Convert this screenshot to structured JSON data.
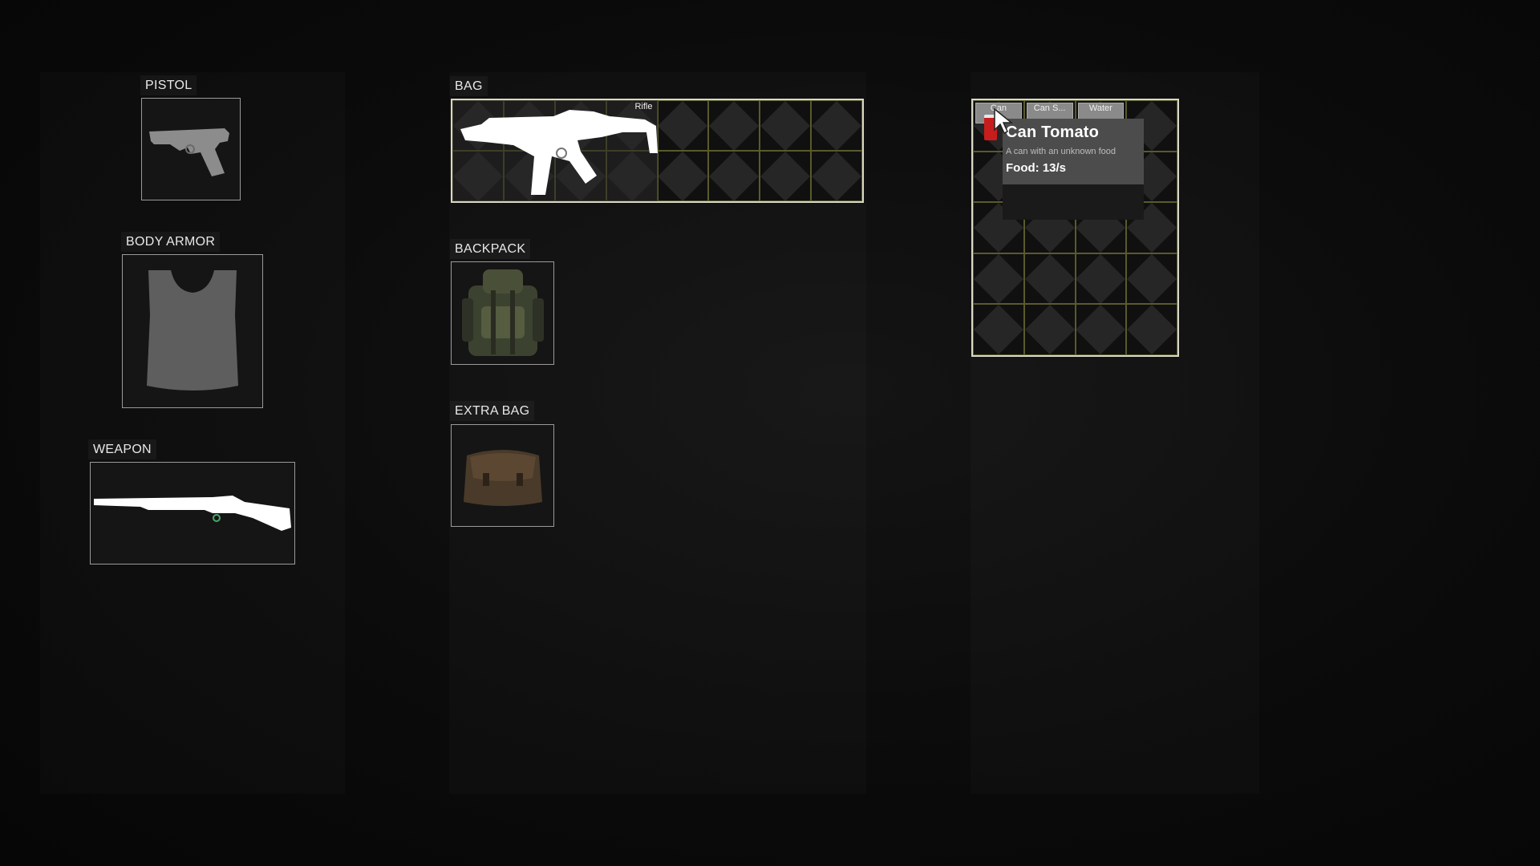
{
  "equipment": {
    "pistol_label": "PISTOL",
    "body_armor_label": "BODY ARMOR",
    "weapon_label": "WEAPON",
    "bag_label": "BAG",
    "backpack_label": "BACKPACK",
    "extra_bag_label": "EXTRA BAG"
  },
  "bag": {
    "columns": 8,
    "rows": 2,
    "item": {
      "name": "Rifle",
      "icon": "rifle-icon"
    }
  },
  "container": {
    "columns": 4,
    "rows": 5,
    "items": [
      {
        "label": "Can",
        "icon": "can-tomato-icon"
      },
      {
        "label": "Can S...",
        "icon": "can-icon"
      },
      {
        "label": "Water",
        "icon": "water-bottle-icon"
      }
    ]
  },
  "tooltip": {
    "title": "Can Tomato",
    "description": "A can with an unknown food",
    "stat": "Food: 13/s"
  },
  "colors": {
    "grid_border": "#d8d8c8",
    "cell_line": "#5a5a2c",
    "tooltip_bg": "#4c4c4c"
  }
}
